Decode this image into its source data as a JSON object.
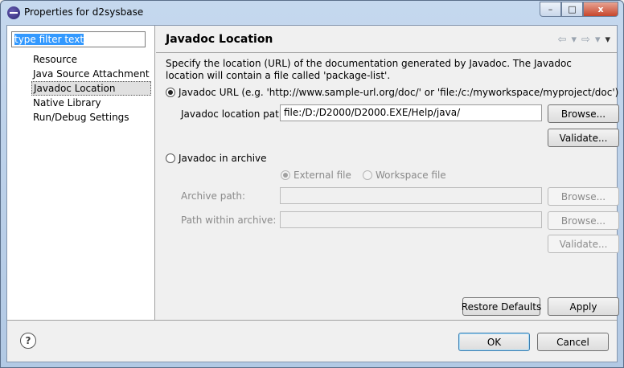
{
  "window": {
    "title": "Properties for d2sysbase",
    "icon": "eclipse-icon",
    "controls": {
      "minimize": "–",
      "maximize": "□",
      "close": "x"
    }
  },
  "sidebar": {
    "filter_text": "type filter text",
    "items": [
      {
        "label": "Resource"
      },
      {
        "label": "Java Source Attachment"
      },
      {
        "label": "Javadoc Location",
        "selected": true
      },
      {
        "label": "Native Library"
      },
      {
        "label": "Run/Debug Settings"
      }
    ]
  },
  "page": {
    "title": "Javadoc Location",
    "nav": {
      "back": "⇦",
      "back_menu": "▾",
      "forward": "⇨",
      "forward_menu": "▾",
      "menu": "▾"
    },
    "description": "Specify the location (URL) of the documentation generated by Javadoc. The Javadoc location will contain a file called 'package-list'.",
    "url_radio": {
      "label": "Javadoc URL (e.g. 'http://www.sample-url.org/doc/' or 'file:/c:/myworkspace/myproject/doc')",
      "selected": true
    },
    "location_label": "Javadoc location path:",
    "location_value": "file:/D:/D2000/D2000.EXE/Help/java/",
    "browse_label": "Browse...",
    "validate_label": "Validate...",
    "archive_radio": {
      "label": "Javadoc in archive",
      "selected": false
    },
    "external_file_label": "External file",
    "workspace_file_label": "Workspace file",
    "archive_path_label": "Archive path:",
    "archive_path_value": "",
    "path_within_label": "Path within archive:",
    "path_within_value": "",
    "archive_browse_label": "Browse...",
    "path_browse_label": "Browse...",
    "archive_validate_label": "Validate...",
    "restore_defaults_label": "Restore Defaults",
    "apply_label": "Apply"
  },
  "footer": {
    "help": "?",
    "ok_label": "OK",
    "cancel_label": "Cancel"
  }
}
